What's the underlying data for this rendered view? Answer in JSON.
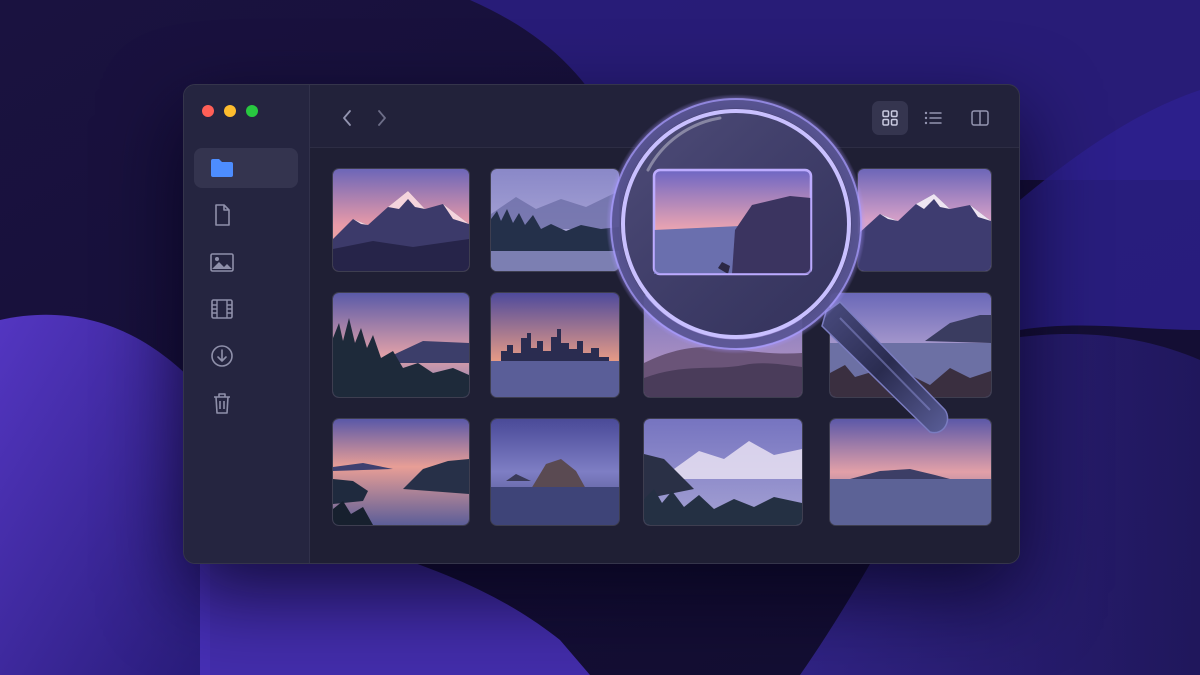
{
  "window": {
    "traffic_lights": [
      {
        "name": "close",
        "color": "#ff5f57"
      },
      {
        "name": "minimize",
        "color": "#febc2e"
      },
      {
        "name": "zoom",
        "color": "#28c840"
      }
    ]
  },
  "sidebar": {
    "items": [
      {
        "icon": "folder-icon",
        "active": true
      },
      {
        "icon": "document-icon",
        "active": false
      },
      {
        "icon": "image-icon",
        "active": false
      },
      {
        "icon": "film-icon",
        "active": false
      },
      {
        "icon": "download-icon",
        "active": false
      },
      {
        "icon": "trash-icon",
        "active": false
      }
    ]
  },
  "toolbar": {
    "nav": [
      "back-icon",
      "forward-icon"
    ],
    "view_modes": [
      {
        "icon": "grid-view-icon",
        "active": true
      },
      {
        "icon": "list-view-icon",
        "active": false
      },
      {
        "icon": "columns-view-icon",
        "active": false
      }
    ]
  },
  "gallery": {
    "columns": 4,
    "rows": 3,
    "items": [
      {
        "scene": "snowy-mountains"
      },
      {
        "scene": "misty-forest-lake"
      },
      {
        "scene": "coastal-cliffs",
        "magnified": true
      },
      {
        "scene": "snowy-mountains"
      },
      {
        "scene": "pine-forest-lake"
      },
      {
        "scene": "city-skyline"
      },
      {
        "scene": "sand-dunes"
      },
      {
        "scene": "rocky-shore"
      },
      {
        "scene": "island-lake"
      },
      {
        "scene": "rock-island"
      },
      {
        "scene": "foggy-forest-mountains"
      },
      {
        "scene": "distant-island"
      }
    ]
  },
  "accent_color": "#8b7cff"
}
